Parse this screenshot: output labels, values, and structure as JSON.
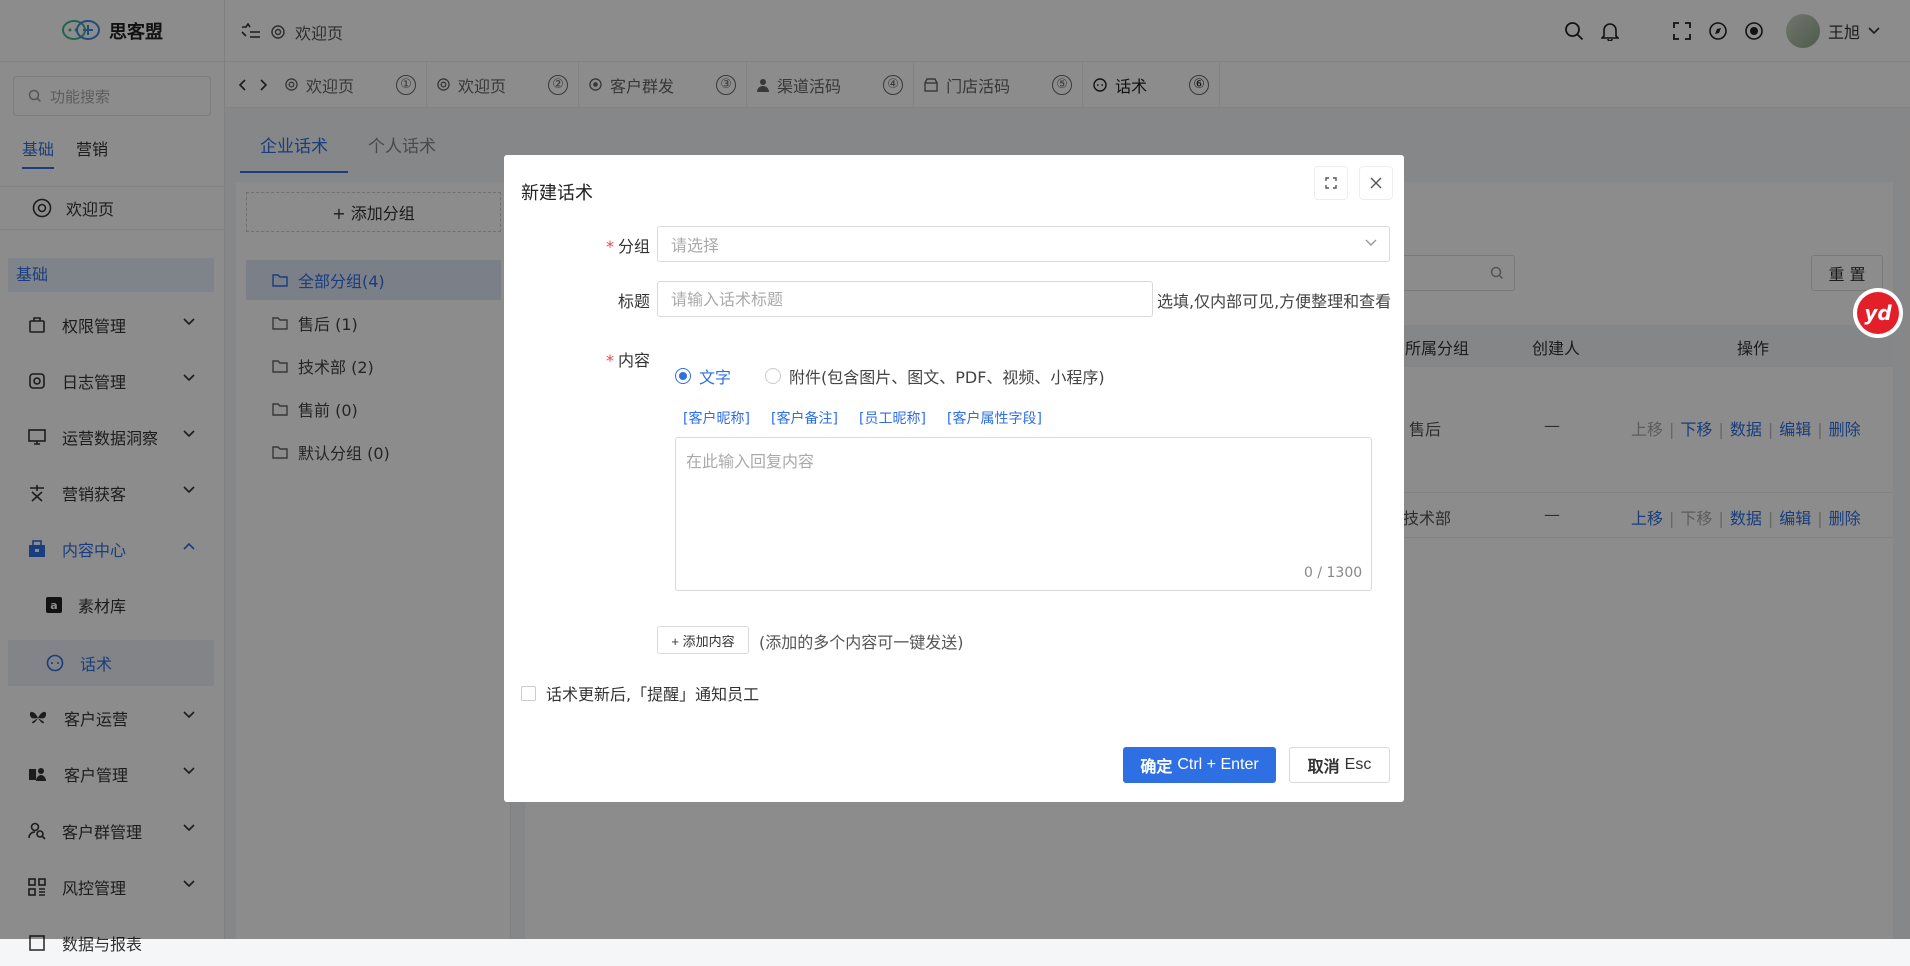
{
  "app": {
    "name": "思客盟"
  },
  "header": {
    "breadcrumb": "欢迎页",
    "user_name": "王旭"
  },
  "sidebar": {
    "search_placeholder": "功能搜索",
    "tabs": [
      "基础",
      "营销"
    ],
    "welcome": "欢迎页",
    "section": "基础",
    "items": [
      {
        "label": "权限管理",
        "icon": "briefcase-icon"
      },
      {
        "label": "日志管理",
        "icon": "log-icon"
      },
      {
        "label": "运营数据洞察",
        "icon": "monitor-icon"
      },
      {
        "label": "营销获客",
        "icon": "marketing-icon"
      },
      {
        "label": "内容中心",
        "icon": "content-icon"
      },
      {
        "label": "素材库",
        "icon": "amazon-icon"
      },
      {
        "label": "话术",
        "icon": "chat-icon"
      },
      {
        "label": "客户运营",
        "icon": "butterfly-icon"
      },
      {
        "label": "客户管理",
        "icon": "customer-icon"
      },
      {
        "label": "客户群管理",
        "icon": "group-search-icon"
      },
      {
        "label": "风控管理",
        "icon": "grid-icon"
      },
      {
        "label": "数据与报表"
      }
    ]
  },
  "page_tabs": [
    {
      "label": "欢迎页",
      "num": "①"
    },
    {
      "label": "欢迎页",
      "num": "②"
    },
    {
      "label": "客户群发",
      "num": "③"
    },
    {
      "label": "渠道活码",
      "num": "④"
    },
    {
      "label": "门店活码",
      "num": "⑤"
    },
    {
      "label": "话术",
      "num": "⑥"
    }
  ],
  "content": {
    "tabs": [
      "企业话术",
      "个人话术"
    ],
    "add_group": "+ 添加分组",
    "groups": [
      "全部分组(4)",
      "售后 (1)",
      "技术部 (2)",
      "售前 (0)",
      "默认分组 (0)"
    ],
    "reset_button": "重 置",
    "table_headers": [
      "所属分组",
      "创建人",
      "操作"
    ],
    "rows": [
      {
        "group": "售后",
        "creator": "—",
        "actions": [
          "上移",
          "下移",
          "数据",
          "编辑",
          "删除"
        ]
      },
      {
        "group": "技术部",
        "creator": "—",
        "actions": [
          "上移",
          "下移",
          "数据",
          "编辑",
          "删除"
        ]
      }
    ]
  },
  "modal": {
    "title": "新建话术",
    "group_label": "分组",
    "group_placeholder": "请选择",
    "title_label": "标题",
    "title_placeholder": "请输入话术标题",
    "title_hint": "选填,仅内部可见,方便整理和查看",
    "content_label": "内容",
    "radio_text": "文字",
    "radio_attach": "附件(包含图片、图文、PDF、视频、小程序)",
    "tokens": [
      "[客户昵称]",
      "[客户备注]",
      "[员工昵称]",
      "[客户属性字段]"
    ],
    "reply_placeholder": "在此输入回复内容",
    "counter": "0 / 1300",
    "add_content": "+ 添加内容",
    "add_hint": "(添加的多个内容可一键发送)",
    "notify": "话术更新后,「提醒」通知员工",
    "ok_main": "确定",
    "ok_shortcut": "Ctrl + Enter",
    "cancel_main": "取消",
    "cancel_shortcut": "Esc"
  },
  "float_badge": "yd",
  "colors": {
    "accent": "#2f6fe4",
    "required": "#e5484d",
    "badge": "#e3202a"
  }
}
